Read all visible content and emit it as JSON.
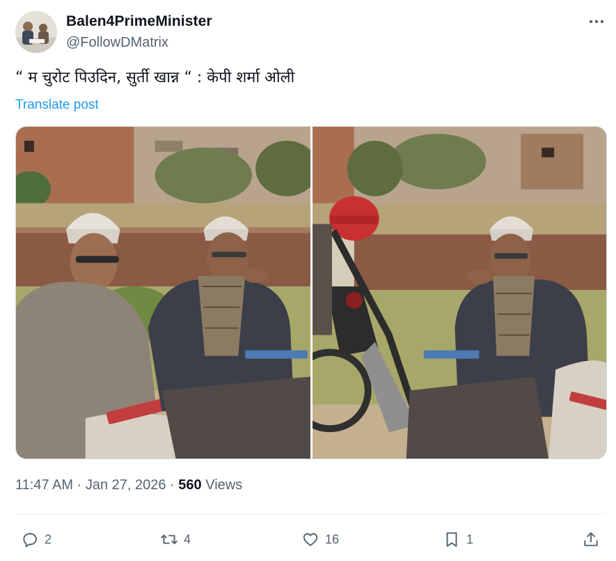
{
  "author": {
    "display_name": "Balen4PrimeMinister",
    "handle": "@FollowDMatrix"
  },
  "tweet": {
    "text": "“ म चुरोट पिउदिन, सुर्ती खान्न “ : केपी शर्मा ओली",
    "translate_label": "Translate post"
  },
  "meta": {
    "time": "11:47 AM",
    "separator": "·",
    "date": "Jan 27, 2026",
    "views_count": "560",
    "views_label": "Views"
  },
  "actions": {
    "replies": "2",
    "reposts": "4",
    "likes": "16",
    "bookmarks": "1"
  },
  "colors": {
    "accent": "#1d9bf0",
    "secondary_text": "#536471",
    "primary_text": "#0f1419",
    "divider": "#eff3f4"
  },
  "icons": {
    "more": "more-horizontal-icon",
    "reply": "reply-bubble-icon",
    "repost": "repost-arrows-icon",
    "like": "heart-icon",
    "bookmark": "bookmark-icon",
    "share": "share-upload-icon"
  }
}
